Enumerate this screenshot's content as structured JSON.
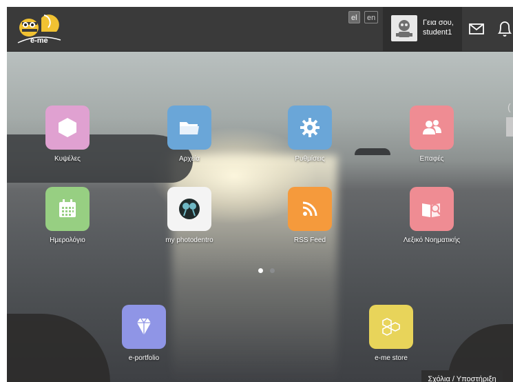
{
  "header": {
    "logo_text": "e-me",
    "languages": [
      "el",
      "en"
    ],
    "greeting_line1": "Γεια σου,",
    "greeting_line2": "student1"
  },
  "apps": [
    {
      "label": "Κυψέλες",
      "color": "#e0a1d1",
      "icon": "hexagon-icon"
    },
    {
      "label": "Αρχεία",
      "color": "#6aa6d8",
      "icon": "folder-icon"
    },
    {
      "label": "Ρυθμίσεις",
      "color": "#6aa6d8",
      "icon": "gear-icon"
    },
    {
      "label": "Επαφές",
      "color": "#ef8c93",
      "icon": "contacts-icon"
    },
    {
      "label": "Ημερολόγιο",
      "color": "#97cf82",
      "icon": "calendar-icon"
    },
    {
      "label": "my photodentro",
      "color": "#f4f4f4",
      "icon": "photodentro-icon"
    },
    {
      "label": "RSS Feed",
      "color": "#f59a3c",
      "icon": "rss-icon"
    },
    {
      "label": "Λεξικό Νοηματικής",
      "color": "#ef8c93",
      "icon": "dictionary-icon"
    },
    {
      "label": "e-portfolio",
      "color": "#8f95e6",
      "icon": "diamond-icon"
    },
    {
      "label": "e-me store",
      "color": "#e8d45a",
      "icon": "honeycomb-icon"
    }
  ],
  "pager": {
    "pages": 2,
    "current": 1
  },
  "feedback_label": "Σχόλια / Υποστήριξη",
  "scroll_hint": "("
}
